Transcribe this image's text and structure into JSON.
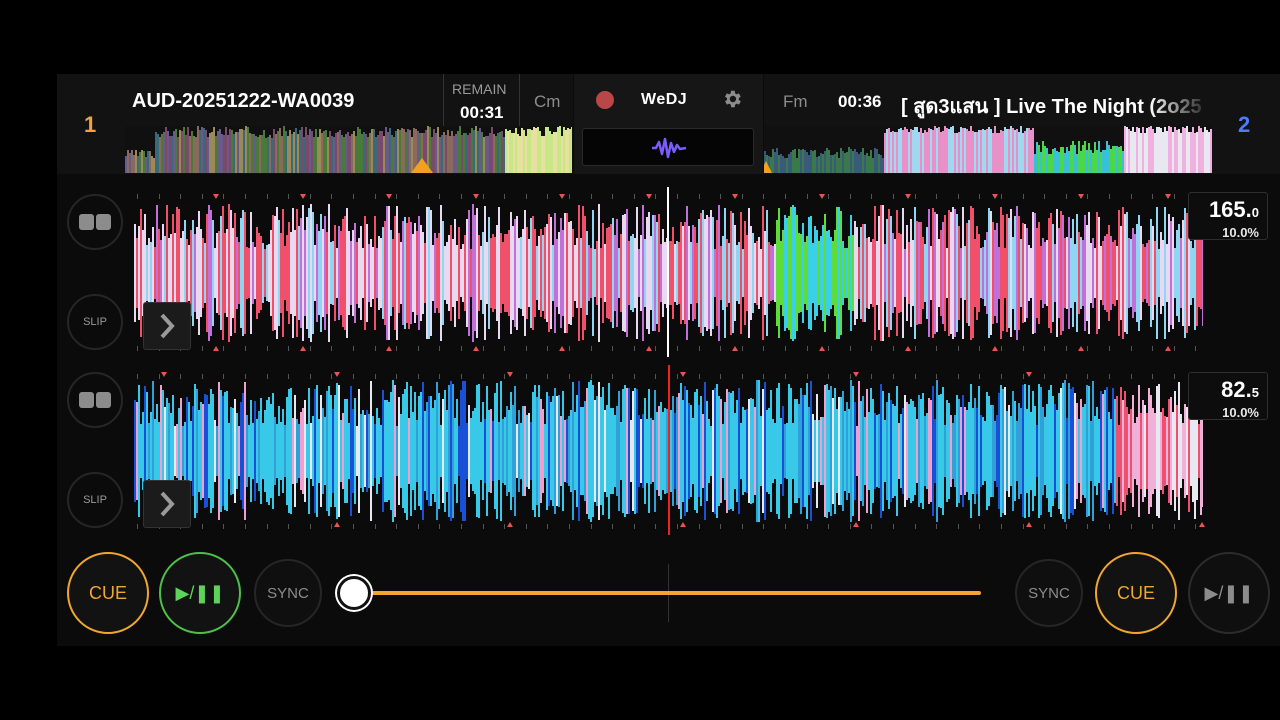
{
  "app": {
    "brand": "WeDJ"
  },
  "deck1": {
    "number": "1",
    "title": "AUD-20251222-WA0039",
    "remain_label": "REMAIN",
    "remain_time": "00:31",
    "key": "Cm",
    "bpm_main": "165.",
    "bpm_decimal": "0",
    "pitch_range": "10.0%",
    "slip_label": "SLIP",
    "cue_label": "CUE",
    "play_label": "▶/❚❚",
    "sync_label": "SYNC",
    "playing": true
  },
  "deck2": {
    "number": "2",
    "title": "[ สูด3แสน ] Live The Night (2o25",
    "time": "00:36",
    "key": "Fm",
    "bpm_main": "82.",
    "bpm_decimal": "5",
    "pitch_range": "10.0%",
    "slip_label": "SLIP",
    "cue_label": "CUE",
    "play_label": "▶/❚❚",
    "sync_label": "SYNC",
    "playing": false
  },
  "crossfader": {
    "position": 0.0
  },
  "colors": {
    "accent_orange": "#f0a630",
    "play_green": "#4cc14a",
    "deck2_blue": "#4c7bff",
    "record_red": "#b94747",
    "wave_view_purple": "#7a5cff"
  },
  "icons": [
    "record-icon",
    "gear-icon",
    "waveform-icon",
    "loop-icon",
    "chevron-right-icon"
  ]
}
